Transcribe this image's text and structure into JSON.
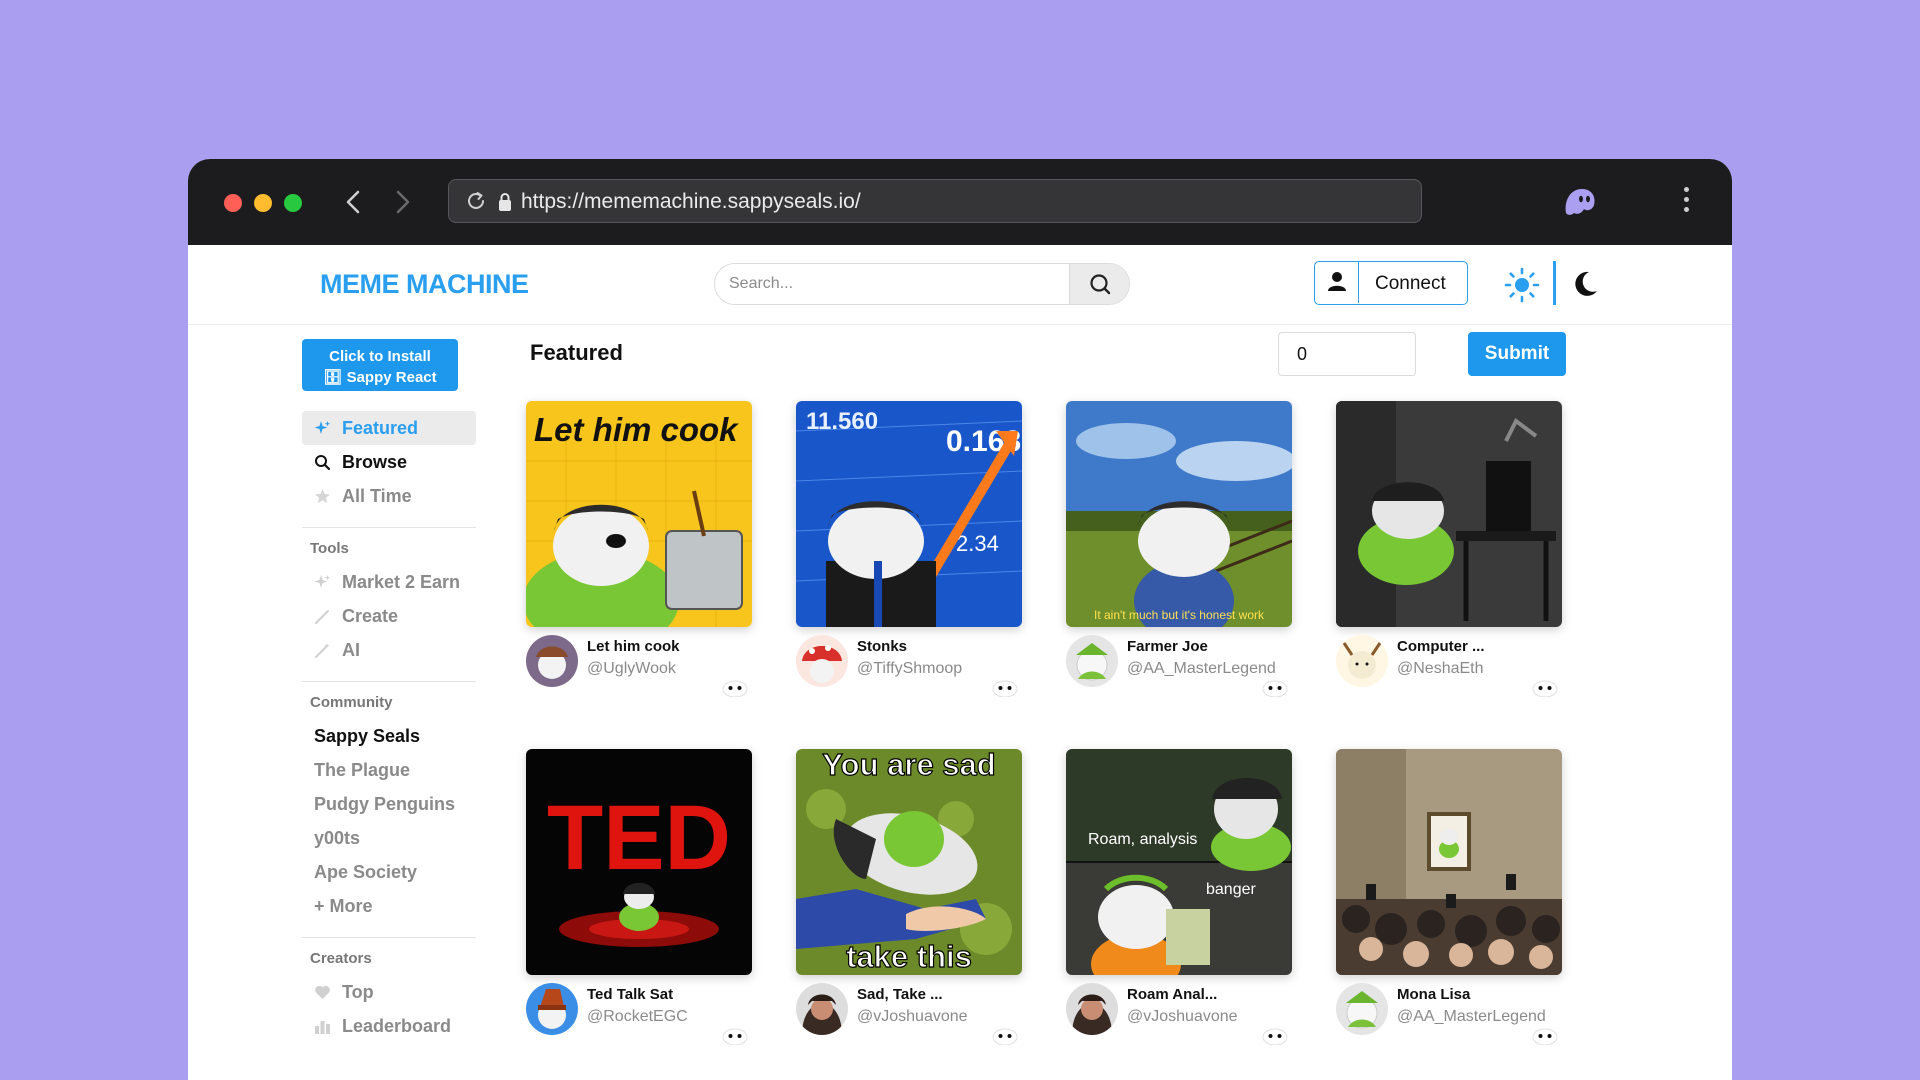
{
  "browser": {
    "url": "https://mememachine.sappyseals.io/"
  },
  "header": {
    "logo": "MEME MACHINE",
    "search_placeholder": "Search...",
    "connect_label": "Connect"
  },
  "sidebar": {
    "install_line1": "Click to Install",
    "install_line2": "🗄 Sappy React",
    "nav": [
      {
        "label": "Featured"
      },
      {
        "label": "Browse"
      },
      {
        "label": "All Time"
      }
    ],
    "tools_title": "Tools",
    "tools": [
      {
        "label": "Market 2 Earn"
      },
      {
        "label": "Create"
      },
      {
        "label": "AI"
      }
    ],
    "community_title": "Community",
    "community": [
      {
        "label": "Sappy Seals"
      },
      {
        "label": "The Plague"
      },
      {
        "label": "Pudgy Penguins"
      },
      {
        "label": "y00ts"
      },
      {
        "label": "Ape Society"
      },
      {
        "label": "+ More"
      }
    ],
    "creators_title": "Creators",
    "creators": [
      {
        "label": "Top"
      },
      {
        "label": "Leaderboard"
      }
    ]
  },
  "main": {
    "title": "Featured",
    "number_value": "0",
    "submit_label": "Submit",
    "cards": [
      {
        "title": "Let him cook",
        "handle": "@UglyWook",
        "meme_text": "Let him cook"
      },
      {
        "title": "Stonks",
        "handle": "@TiffyShmoop",
        "meme_text": "11.560"
      },
      {
        "title": "Farmer Joe",
        "handle": "@AA_MasterLegend",
        "meme_text": "It ain't much but it's honest work"
      },
      {
        "title": "Computer ...",
        "handle": "@NeshaEth",
        "meme_text": ""
      },
      {
        "title": "Ted Talk Sat",
        "handle": "@RocketEGC",
        "meme_text": "TED"
      },
      {
        "title": "Sad, Take ...",
        "handle": "@vJoshuavone",
        "meme_text": "You are sad",
        "meme_text2": "take this"
      },
      {
        "title": "Roam Anal...",
        "handle": "@vJoshuavone",
        "meme_text": "Roam, analysis",
        "meme_text2": "banger"
      },
      {
        "title": "Mona Lisa",
        "handle": "@AA_MasterLegend",
        "meme_text": ""
      }
    ]
  },
  "colors": {
    "background": "#a99ef0",
    "accent": "#1d98ec",
    "chrome": "#1c1c1e"
  }
}
